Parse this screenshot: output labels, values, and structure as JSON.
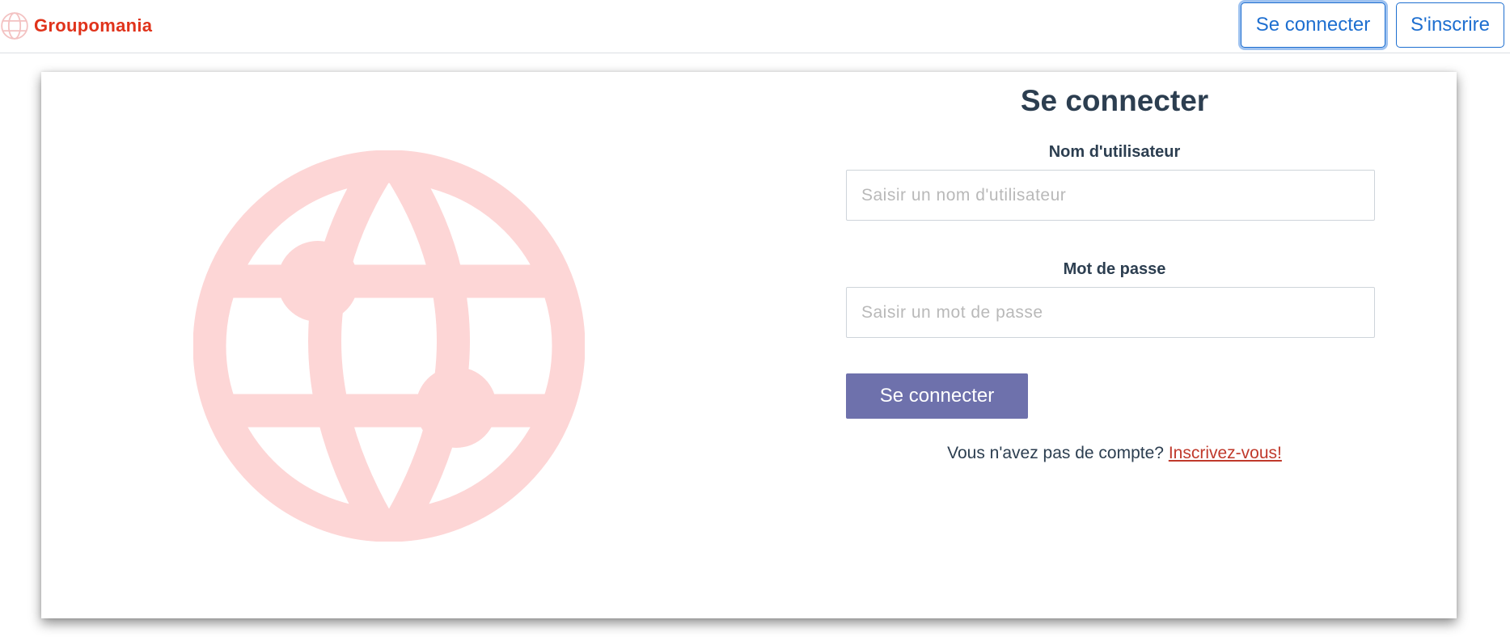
{
  "brand": {
    "name": "Groupomania",
    "icon": "globe-icon",
    "color": "#e0331b"
  },
  "nav": {
    "login_label": "Se connecter",
    "signup_label": "S'inscrire",
    "accent": "#1e6fd0"
  },
  "illustration": {
    "icon": "globe-icon",
    "color": "#fdd6d6"
  },
  "form": {
    "title": "Se connecter",
    "username_label": "Nom d'utilisateur",
    "username_placeholder": "Saisir un nom d'utilisateur",
    "username_value": "",
    "password_label": "Mot de passe",
    "password_placeholder": "Saisir un mot de passe",
    "password_value": "",
    "submit_label": "Se connecter",
    "submit_color": "#6e71ac",
    "signup_prompt": "Vous n'avez pas de compte?",
    "signup_link": "Inscrivez-vous!"
  }
}
